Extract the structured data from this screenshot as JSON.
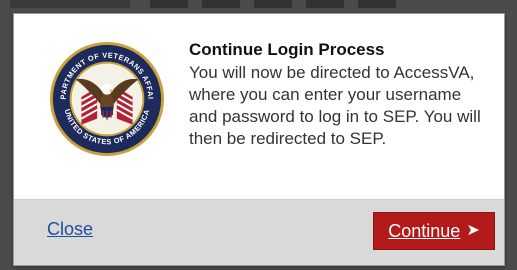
{
  "dialog": {
    "title": "Continue Login Process",
    "message": "You will now be directed to AccessVA, where you can enter your username and password to log in to SEP. You will then be redirected to SEP.",
    "seal": {
      "icon": "va-seal-icon",
      "ring_text_top": "DEPARTMENT OF VETERANS AFFAIRS",
      "ring_text_bottom": "UNITED STATES OF AMERICA"
    }
  },
  "footer": {
    "close_label": "Close",
    "continue_label": "Continue",
    "continue_icon": "arrow-right-icon"
  },
  "colors": {
    "link": "#1f4e9c",
    "button_bg": "#b31b1b",
    "footer_bg": "#d9d9d9",
    "overlay": "#4a4a4a"
  }
}
